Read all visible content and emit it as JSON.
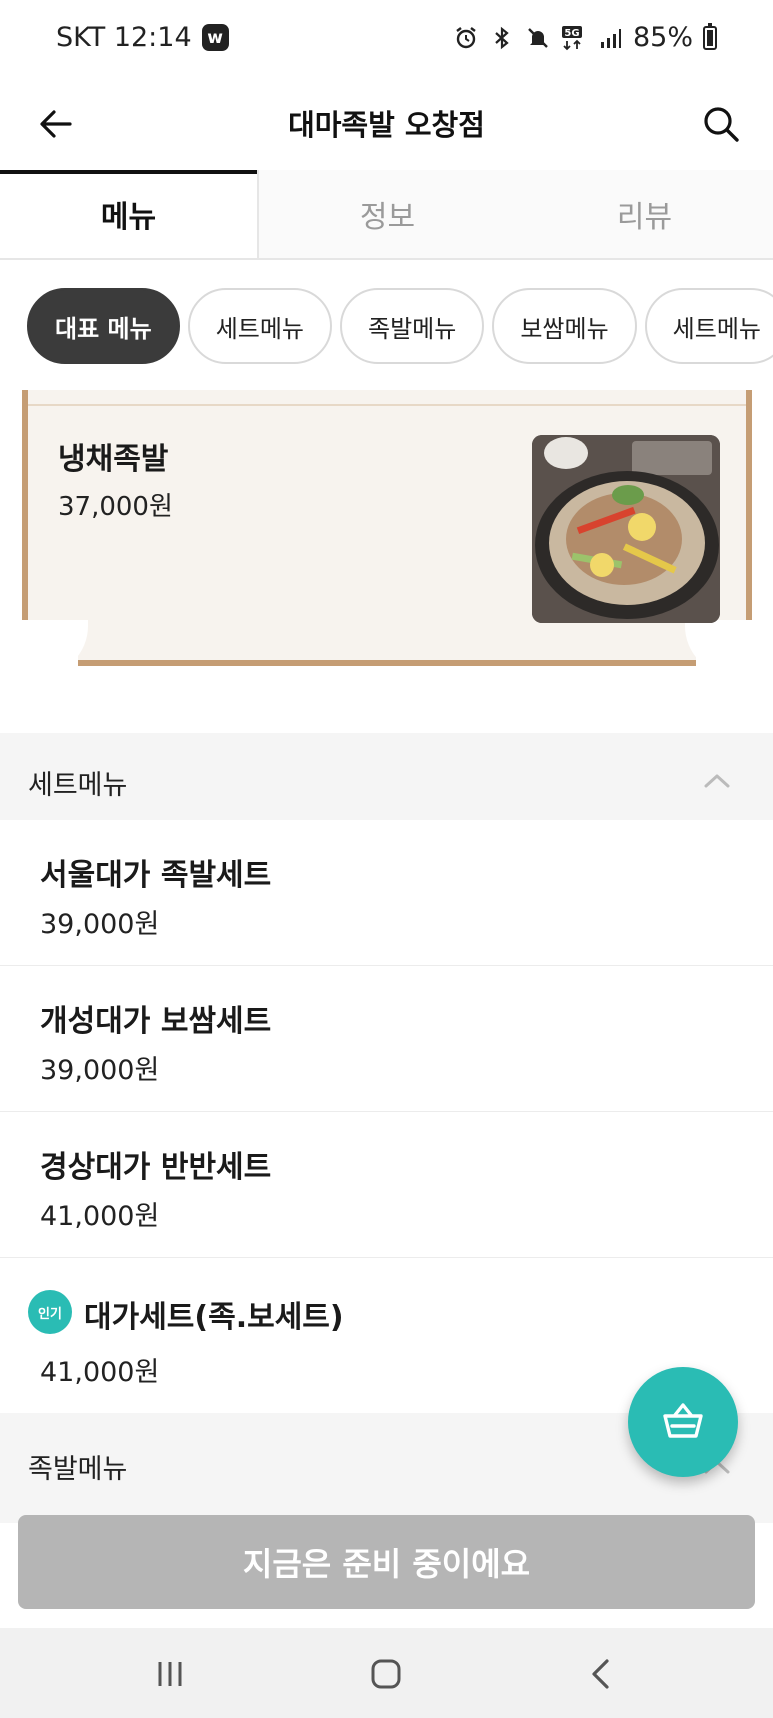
{
  "status_bar": {
    "carrier_time": "SKT 12:14",
    "app_badge": "w",
    "network": "5G",
    "battery": "85%"
  },
  "header": {
    "title": "대마족발 오창점"
  },
  "tabs": [
    {
      "label": "메뉴",
      "active": true
    },
    {
      "label": "정보",
      "active": false
    },
    {
      "label": "리뷰",
      "active": false
    }
  ],
  "chips": [
    {
      "label": "대표 메뉴",
      "active": true
    },
    {
      "label": "세트메뉴",
      "active": false
    },
    {
      "label": "족발메뉴",
      "active": false
    },
    {
      "label": "보쌈메뉴",
      "active": false
    },
    {
      "label": "세트메뉴",
      "active": false
    }
  ],
  "featured": {
    "name": "냉채족발",
    "price": "37,000원"
  },
  "sections": [
    {
      "title": "세트메뉴",
      "items": [
        {
          "name": "서울대가 족발세트",
          "price": "39,000원"
        },
        {
          "name": "개성대가 보쌈세트",
          "price": "39,000원"
        },
        {
          "name": "경상대가 반반세트",
          "price": "41,000원"
        },
        {
          "name": "대가세트(족.보세트)",
          "price": "41,000원",
          "badge": "인기"
        }
      ]
    },
    {
      "title": "족발메뉴",
      "items": []
    }
  ],
  "cta": {
    "label": "지금은 준비 중이에요"
  },
  "colors": {
    "accent": "#2abcb4",
    "chip_active": "#3b3b3b",
    "paper_border": "#c59d74",
    "cta_disabled": "#b5b5b5"
  }
}
